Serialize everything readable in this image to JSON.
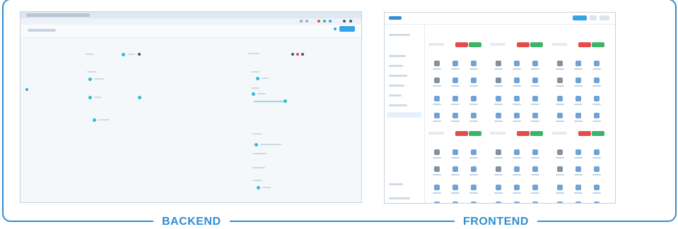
{
  "labels": {
    "backend": "BACKEND",
    "frontend": "FRONTEND"
  },
  "colors": {
    "frame": "#2f8fd4",
    "accent": "#35a3e6",
    "node": "#2ebfcf",
    "badge_red": "#e54b4b",
    "badge_green": "#3bb36a"
  },
  "backend": {
    "description_icons": [
      "workflow-node-icon",
      "connector-icon"
    ]
  },
  "frontend": {
    "card_count": 6,
    "icon_set": [
      "dashboard-icon",
      "user-icon",
      "chart-icon",
      "calendar-icon",
      "document-icon"
    ]
  }
}
